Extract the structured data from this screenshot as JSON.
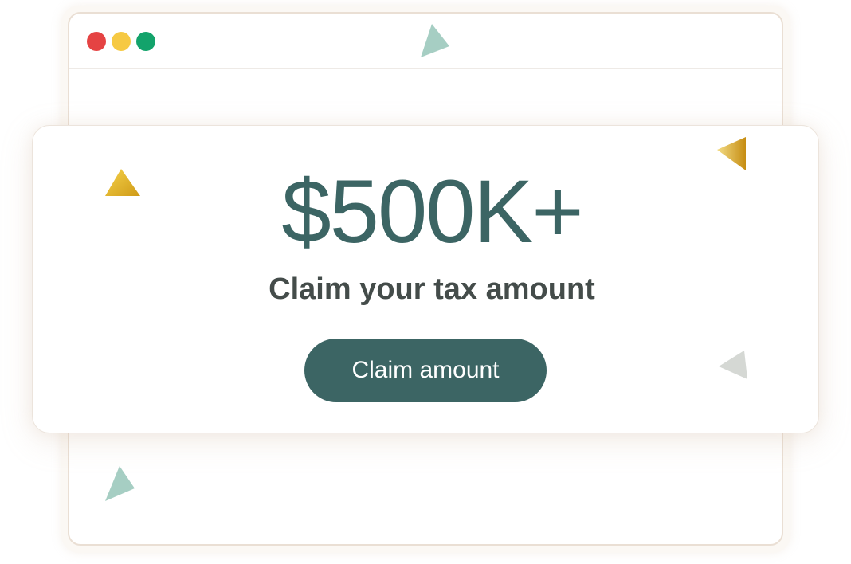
{
  "window": {
    "controls": [
      {
        "name": "close",
        "color": "#e54343"
      },
      {
        "name": "minimize",
        "color": "#f6c943"
      },
      {
        "name": "maximize",
        "color": "#13a36b"
      }
    ]
  },
  "offer": {
    "amount": "$500K+",
    "subtitle": "Claim your tax amount",
    "button_label": "Claim amount"
  },
  "colors": {
    "accent": "#3c6564",
    "text_dark": "#444c4a",
    "triangle_mint": "#a6cec3",
    "triangle_gold": "#e0b021",
    "triangle_grey": "#d5d8d4"
  },
  "decorations": [
    "mint-triangle",
    "gold-triangle",
    "gold-triangle",
    "grey-triangle",
    "mint-triangle"
  ]
}
